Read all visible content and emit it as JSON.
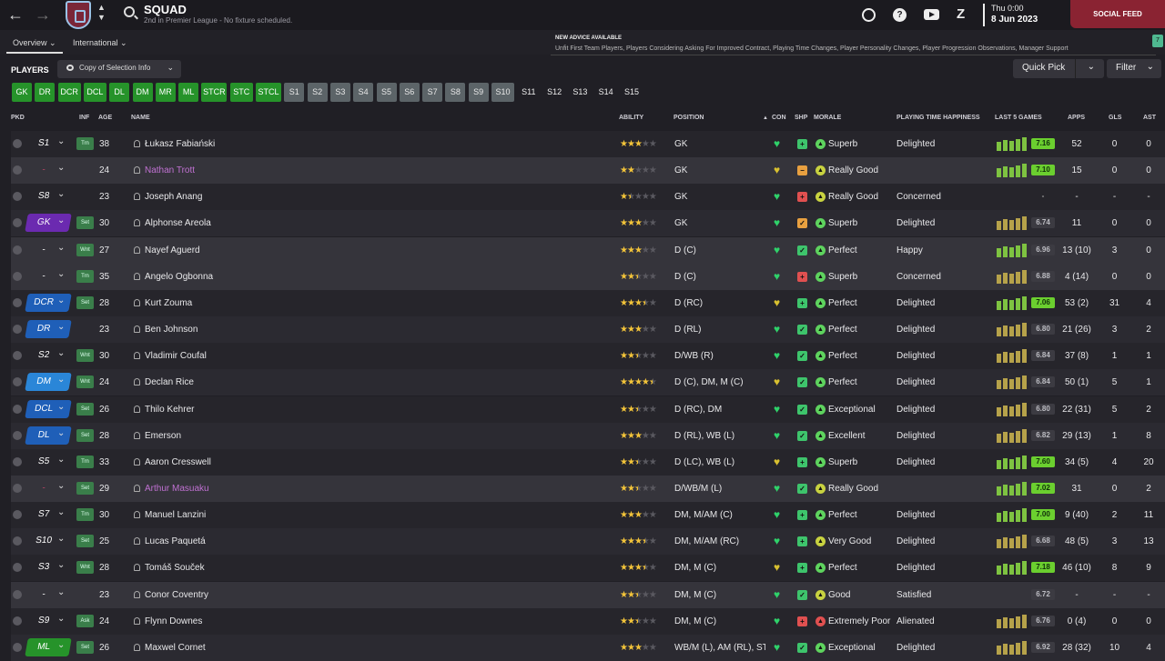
{
  "header": {
    "title": "SQUAD",
    "subtitle": "2nd in Premier League - No fixture scheduled.",
    "time": "Thu 0:00",
    "date": "8 Jun 2023",
    "social_feed": "SOCIAL FEED",
    "help_glyph": "?",
    "z_glyph": "Z",
    "back_glyph": "←",
    "forward_glyph": "→",
    "up_glyph": "▲",
    "down_glyph": "▼"
  },
  "tabs": [
    {
      "label": "Overview ⌄"
    },
    {
      "label": "International ⌄"
    }
  ],
  "advice": {
    "title": "NEW ADVICE AVAILABLE",
    "text": "Unfit First Team Players, Players Considering Asking For Improved Contract, Playing Time Changes, Player Personality Changes, Player Progression Observations, Manager Support",
    "badge": "7"
  },
  "toolbar": {
    "players_label": "PLAYERS",
    "copy_label": "Copy of Selection Info",
    "quick_pick": "Quick Pick",
    "filter": "Filter",
    "chevron": "⌄"
  },
  "position_buttons": [
    {
      "label": "GK",
      "style": "green"
    },
    {
      "label": "DR",
      "style": "green"
    },
    {
      "label": "DCR",
      "style": "green"
    },
    {
      "label": "DCL",
      "style": "green"
    },
    {
      "label": "DL",
      "style": "green"
    },
    {
      "label": "DM",
      "style": "green"
    },
    {
      "label": "MR",
      "style": "green"
    },
    {
      "label": "ML",
      "style": "green"
    },
    {
      "label": "STCR",
      "style": "green"
    },
    {
      "label": "STC",
      "style": "green"
    },
    {
      "label": "STCL",
      "style": "green"
    },
    {
      "label": "S1",
      "style": "grey"
    },
    {
      "label": "S2",
      "style": "grey"
    },
    {
      "label": "S3",
      "style": "grey"
    },
    {
      "label": "S4",
      "style": "grey"
    },
    {
      "label": "S5",
      "style": "grey"
    },
    {
      "label": "S6",
      "style": "grey"
    },
    {
      "label": "S7",
      "style": "grey"
    },
    {
      "label": "S8",
      "style": "grey"
    },
    {
      "label": "S9",
      "style": "grey"
    },
    {
      "label": "S10",
      "style": "grey"
    },
    {
      "label": "S11",
      "style": "dark"
    },
    {
      "label": "S12",
      "style": "dark"
    },
    {
      "label": "S13",
      "style": "dark"
    },
    {
      "label": "S14",
      "style": "dark"
    },
    {
      "label": "S15",
      "style": "dark"
    }
  ],
  "columns": {
    "pkd": "PKD",
    "inf": "INF",
    "age": "AGE",
    "name": "NAME",
    "ability": "ABILITY",
    "position": "POSITION",
    "con": "CON",
    "shp": "SHP",
    "morale": "MORALE",
    "pth": "PLAYING TIME HAPPINESS",
    "last5": "LAST 5 GAMES",
    "apps": "APPS",
    "gls": "GLS",
    "ast": "AST"
  },
  "colors": {
    "pos_gk": "#6b2ab0",
    "pos_blue": "#1f5fb8",
    "pos_bright": "#2a86d8",
    "pos_green": "#26932a",
    "con_green": "#2fd26a",
    "con_yellow": "#d8c030",
    "shp_green": "#3ec46c",
    "shp_orange": "#e8a040",
    "shp_red": "#e05050",
    "mor_green": "#5ed35e",
    "mor_yellow": "#c8d240",
    "mor_red": "#e05050",
    "bar_green": "#7ec341",
    "bar_olive": "#b6a24a"
  },
  "players": [
    {
      "pkd": "S1",
      "pkd_style": "plain",
      "inf": "Trn",
      "age": "38",
      "name": "Łukasz Fabiański",
      "loan": false,
      "stars": 3,
      "pos": "GK",
      "con": "green",
      "shp": "green",
      "shp_glyph": "+",
      "mor": "green",
      "morale": "Superb",
      "pth": "Delighted",
      "bars": [
        "g",
        "g",
        "g",
        "g",
        "g"
      ],
      "rating": "7.16",
      "rating_style": "hi",
      "apps": "52",
      "gls": "0",
      "ast": "0"
    },
    {
      "pkd": "-",
      "pkd_style": "dash",
      "inf": "",
      "age": "24",
      "name": "Nathan Trott",
      "loan": true,
      "stars": 2,
      "pos": "GK",
      "con": "yellow",
      "shp": "orange",
      "shp_glyph": "−",
      "mor": "yellow",
      "morale": "Really Good",
      "pth": "",
      "bars": [
        "g",
        "g",
        "g",
        "g",
        "g"
      ],
      "rating": "7.10",
      "rating_style": "hi",
      "apps": "15",
      "gls": "0",
      "ast": "0"
    },
    {
      "pkd": "S8",
      "pkd_style": "plain",
      "inf": "",
      "age": "23",
      "name": "Joseph Anang",
      "loan": false,
      "stars": 1.5,
      "pos": "GK",
      "con": "green",
      "shp": "red",
      "shp_glyph": "+",
      "mor": "yellow",
      "morale": "Really Good",
      "pth": "Concerned",
      "bars": [],
      "rating": "-",
      "rating_style": "nil",
      "apps": "-",
      "gls": "-",
      "ast": "-"
    },
    {
      "pkd": "GK",
      "pkd_style": "gk",
      "inf": "Set",
      "age": "30",
      "name": "Alphonse Areola",
      "loan": false,
      "stars": 3,
      "pos": "GK",
      "con": "green",
      "shp": "orange",
      "shp_glyph": "✓",
      "mor": "green",
      "morale": "Superb",
      "pth": "Delighted",
      "bars": [
        "o",
        "o",
        "o",
        "o",
        "o"
      ],
      "rating": "6.74",
      "rating_style": "md",
      "apps": "11",
      "gls": "0",
      "ast": "0"
    },
    {
      "pkd": "-",
      "pkd_style": "plain",
      "inf": "Wnt",
      "age": "27",
      "name": "Nayef Aguerd",
      "loan": false,
      "stars": 3,
      "pos": "D (C)",
      "con": "green",
      "shp": "green",
      "shp_glyph": "✓",
      "mor": "green",
      "morale": "Perfect",
      "pth": "Happy",
      "bars": [
        "g",
        "g",
        "g",
        "g",
        "g"
      ],
      "rating": "6.96",
      "rating_style": "md",
      "apps": "13 (10)",
      "gls": "3",
      "ast": "0"
    },
    {
      "pkd": "-",
      "pkd_style": "plain",
      "inf": "Trn",
      "age": "35",
      "name": "Angelo Ogbonna",
      "loan": false,
      "stars": 2.5,
      "pos": "D (C)",
      "con": "green",
      "shp": "red",
      "shp_glyph": "+",
      "mor": "green",
      "morale": "Superb",
      "pth": "Concerned",
      "bars": [
        "o",
        "o",
        "o",
        "o",
        "o"
      ],
      "rating": "6.88",
      "rating_style": "md",
      "apps": "4 (14)",
      "gls": "0",
      "ast": "0"
    },
    {
      "pkd": "DCR",
      "pkd_style": "blue",
      "inf": "Set",
      "age": "28",
      "name": "Kurt Zouma",
      "loan": false,
      "stars": 3.5,
      "pos": "D (RC)",
      "con": "yellow",
      "shp": "green",
      "shp_glyph": "+",
      "mor": "green",
      "morale": "Perfect",
      "pth": "Delighted",
      "bars": [
        "g",
        "g",
        "g",
        "g",
        "g"
      ],
      "rating": "7.06",
      "rating_style": "hi",
      "apps": "53 (2)",
      "gls": "31",
      "ast": "4"
    },
    {
      "pkd": "DR",
      "pkd_style": "blue",
      "inf": "",
      "age": "23",
      "name": "Ben Johnson",
      "loan": false,
      "stars": 3,
      "pos": "D (RL)",
      "con": "green",
      "shp": "green",
      "shp_glyph": "✓",
      "mor": "green",
      "morale": "Perfect",
      "pth": "Delighted",
      "bars": [
        "o",
        "o",
        "o",
        "o",
        "o"
      ],
      "rating": "6.80",
      "rating_style": "md",
      "apps": "21 (26)",
      "gls": "3",
      "ast": "2"
    },
    {
      "pkd": "S2",
      "pkd_style": "plain",
      "inf": "Wnt",
      "age": "30",
      "name": "Vladimir Coufal",
      "loan": false,
      "stars": 2.5,
      "pos": "D/WB (R)",
      "con": "green",
      "shp": "green",
      "shp_glyph": "✓",
      "mor": "green",
      "morale": "Perfect",
      "pth": "Delighted",
      "bars": [
        "o",
        "o",
        "o",
        "o",
        "o"
      ],
      "rating": "6.84",
      "rating_style": "md",
      "apps": "37 (8)",
      "gls": "1",
      "ast": "1"
    },
    {
      "pkd": "DM",
      "pkd_style": "bright",
      "inf": "Wnt",
      "age": "24",
      "name": "Declan Rice",
      "loan": false,
      "stars": 4.5,
      "pos": "D (C), DM, M (C)",
      "con": "yellow",
      "shp": "green",
      "shp_glyph": "✓",
      "mor": "green",
      "morale": "Perfect",
      "pth": "Delighted",
      "bars": [
        "o",
        "o",
        "o",
        "o",
        "o"
      ],
      "rating": "6.84",
      "rating_style": "md",
      "apps": "50 (1)",
      "gls": "5",
      "ast": "1"
    },
    {
      "pkd": "DCL",
      "pkd_style": "blue",
      "inf": "Set",
      "age": "26",
      "name": "Thilo Kehrer",
      "loan": false,
      "stars": 2.5,
      "pos": "D (RC), DM",
      "con": "green",
      "shp": "green",
      "shp_glyph": "✓",
      "mor": "green",
      "morale": "Exceptional",
      "pth": "Delighted",
      "bars": [
        "o",
        "o",
        "o",
        "o",
        "o"
      ],
      "rating": "6.80",
      "rating_style": "md",
      "apps": "22 (31)",
      "gls": "5",
      "ast": "2"
    },
    {
      "pkd": "DL",
      "pkd_style": "blue",
      "inf": "Set",
      "age": "28",
      "name": "Emerson",
      "loan": false,
      "stars": 3,
      "pos": "D (RL), WB (L)",
      "con": "green",
      "shp": "green",
      "shp_glyph": "✓",
      "mor": "green",
      "morale": "Excellent",
      "pth": "Delighted",
      "bars": [
        "o",
        "o",
        "o",
        "o",
        "o"
      ],
      "rating": "6.82",
      "rating_style": "md",
      "apps": "29 (13)",
      "gls": "1",
      "ast": "8"
    },
    {
      "pkd": "S5",
      "pkd_style": "plain",
      "inf": "Trn",
      "age": "33",
      "name": "Aaron Cresswell",
      "loan": false,
      "stars": 2.5,
      "pos": "D (LC), WB (L)",
      "con": "yellow",
      "shp": "green",
      "shp_glyph": "+",
      "mor": "green",
      "morale": "Superb",
      "pth": "Delighted",
      "bars": [
        "g",
        "g",
        "g",
        "g",
        "g"
      ],
      "rating": "7.60",
      "rating_style": "hi",
      "apps": "34 (5)",
      "gls": "4",
      "ast": "20"
    },
    {
      "pkd": "-",
      "pkd_style": "dash",
      "inf": "Set",
      "age": "29",
      "name": "Arthur Masuaku",
      "loan": true,
      "stars": 2.5,
      "pos": "D/WB/M (L)",
      "con": "green",
      "shp": "green",
      "shp_glyph": "✓",
      "mor": "yellow",
      "morale": "Really Good",
      "pth": "",
      "bars": [
        "g",
        "g",
        "g",
        "g",
        "g"
      ],
      "rating": "7.02",
      "rating_style": "hi",
      "apps": "31",
      "gls": "0",
      "ast": "2"
    },
    {
      "pkd": "S7",
      "pkd_style": "plain",
      "inf": "Trn",
      "age": "30",
      "name": "Manuel Lanzini",
      "loan": false,
      "stars": 3,
      "pos": "DM, M/AM (C)",
      "con": "green",
      "shp": "green",
      "shp_glyph": "+",
      "mor": "green",
      "morale": "Perfect",
      "pth": "Delighted",
      "bars": [
        "g",
        "g",
        "g",
        "g",
        "g"
      ],
      "rating": "7.00",
      "rating_style": "hi",
      "apps": "9 (40)",
      "gls": "2",
      "ast": "11"
    },
    {
      "pkd": "S10",
      "pkd_style": "plain",
      "inf": "Set",
      "age": "25",
      "name": "Lucas Paquetá",
      "loan": false,
      "stars": 3.5,
      "pos": "DM, M/AM (RC)",
      "con": "green",
      "shp": "green",
      "shp_glyph": "+",
      "mor": "yellow",
      "morale": "Very Good",
      "pth": "Delighted",
      "bars": [
        "o",
        "o",
        "o",
        "o",
        "o"
      ],
      "rating": "6.68",
      "rating_style": "md",
      "apps": "48 (5)",
      "gls": "3",
      "ast": "13"
    },
    {
      "pkd": "S3",
      "pkd_style": "plain",
      "inf": "Wnt",
      "age": "28",
      "name": "Tomáš Souček",
      "loan": false,
      "stars": 3.5,
      "pos": "DM, M (C)",
      "con": "yellow",
      "shp": "green",
      "shp_glyph": "+",
      "mor": "green",
      "morale": "Perfect",
      "pth": "Delighted",
      "bars": [
        "g",
        "g",
        "g",
        "g",
        "g"
      ],
      "rating": "7.18",
      "rating_style": "hi",
      "apps": "46 (10)",
      "gls": "8",
      "ast": "9"
    },
    {
      "pkd": "-",
      "pkd_style": "plain",
      "inf": "",
      "age": "23",
      "name": "Conor Coventry",
      "loan": false,
      "stars": 2.5,
      "pos": "DM, M (C)",
      "con": "green",
      "shp": "green",
      "shp_glyph": "✓",
      "mor": "yellow",
      "morale": "Good",
      "pth": "Satisfied",
      "bars": [],
      "rating": "6.72",
      "rating_style": "md",
      "apps": "-",
      "gls": "-",
      "ast": "-"
    },
    {
      "pkd": "S9",
      "pkd_style": "plain",
      "inf": "Ask",
      "age": "24",
      "name": "Flynn Downes",
      "loan": false,
      "stars": 2.5,
      "pos": "DM, M (C)",
      "con": "green",
      "shp": "red",
      "shp_glyph": "+",
      "mor": "red",
      "morale": "Extremely Poor",
      "pth": "Alienated",
      "bars": [
        "o",
        "o",
        "o",
        "o",
        "o"
      ],
      "rating": "6.76",
      "rating_style": "md",
      "apps": "0 (4)",
      "gls": "0",
      "ast": "0"
    },
    {
      "pkd": "ML",
      "pkd_style": "green",
      "inf": "Set",
      "age": "26",
      "name": "Maxwel Cornet",
      "loan": false,
      "stars": 3,
      "pos": "WB/M (L), AM (RL), ST...",
      "con": "green",
      "shp": "green",
      "shp_glyph": "✓",
      "mor": "green",
      "morale": "Exceptional",
      "pth": "Delighted",
      "bars": [
        "o",
        "o",
        "o",
        "o",
        "o"
      ],
      "rating": "6.92",
      "rating_style": "md",
      "apps": "28 (32)",
      "gls": "10",
      "ast": "4"
    }
  ]
}
